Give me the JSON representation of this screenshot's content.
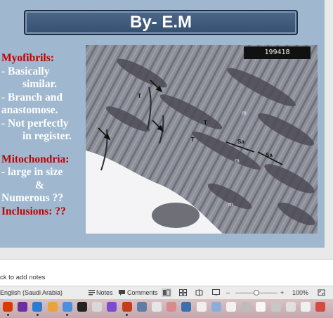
{
  "slide": {
    "title": "By- E.M",
    "text": {
      "myofibrils_heading": "Myofibrils:",
      "line1": "- Basically",
      "line2": "similar.",
      "line3": "- Branch and",
      "line4": "anastomose.",
      "line5": "- Not perfectly",
      "line6": "in register.",
      "mito_heading": "Mitochondria:",
      "line7": "- large in size",
      "line8": "&",
      "line9": "Numerous ??",
      "inclusions": "Inclusions: ??"
    },
    "micrograph": {
      "stamp": "199418",
      "labels": {
        "t1": "T",
        "t2": "T",
        "t3": "T",
        "m1": "m",
        "m2": "m",
        "m3": "m",
        "sa1": "Sa",
        "sa2": "Sa"
      }
    }
  },
  "notes": {
    "placeholder": "ck to add notes"
  },
  "status_bar": {
    "language": "English (Saudi Arabia)",
    "notes_label": "Notes",
    "comments_label": "Comments",
    "zoom_minus": "–",
    "zoom_plus": "+",
    "zoom_level": "100%",
    "zoom_fraction": 0.5
  },
  "dock": {
    "apps": [
      {
        "name": "office",
        "color": "#d83b01"
      },
      {
        "name": "generic",
        "color": "#6b2fa3"
      },
      {
        "name": "generic",
        "color": "#2b7cd3"
      },
      {
        "name": "generic",
        "color": "#e8a33d"
      },
      {
        "name": "generic",
        "color": "#4a90e2"
      },
      {
        "name": "generic",
        "color": "#222222"
      },
      {
        "name": "generic",
        "color": "#d9d9d9"
      },
      {
        "name": "generic",
        "color": "#7a4bd1"
      },
      {
        "name": "powerpoint",
        "color": "#c43e1c"
      },
      {
        "name": "generic",
        "color": "#5f7ea6"
      },
      {
        "name": "generic",
        "color": "#e6e6e6"
      },
      {
        "name": "generic",
        "color": "#d98a8a"
      },
      {
        "name": "generic",
        "color": "#3a6fb0"
      },
      {
        "name": "generic",
        "color": "#efefef"
      },
      {
        "name": "generic",
        "color": "#8aaed9"
      },
      {
        "name": "generic",
        "color": "#f2f2f2"
      },
      {
        "name": "generic",
        "color": "#bcbcbc"
      },
      {
        "name": "generic",
        "color": "#f7f7f7"
      },
      {
        "name": "generic",
        "color": "#c7c7c7"
      },
      {
        "name": "generic",
        "color": "#e0e0e0"
      },
      {
        "name": "generic",
        "color": "#f0f0f0"
      },
      {
        "name": "generic",
        "color": "#d54b3d"
      }
    ]
  }
}
